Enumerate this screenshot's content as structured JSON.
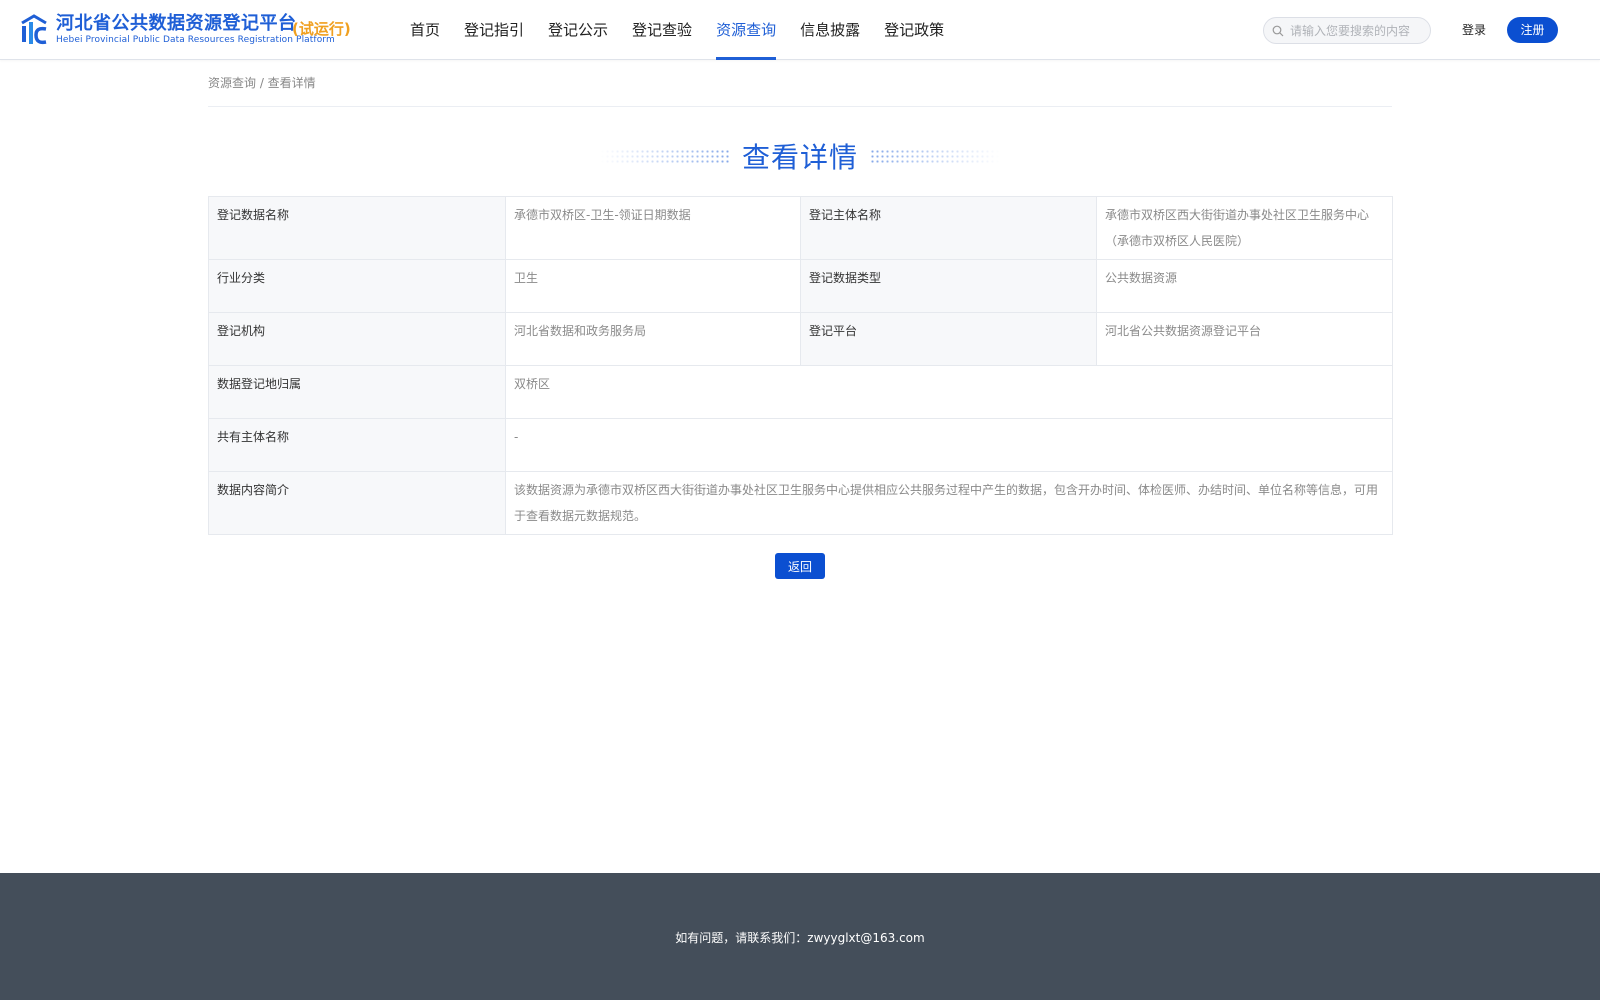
{
  "header": {
    "logo_title": "河北省公共数据资源登记平台",
    "logo_subtitle": "Hebei Provincial Public Data Resources Registration Platform",
    "logo_trial": "(试运行)",
    "nav": [
      "首页",
      "登记指引",
      "登记公示",
      "登记查验",
      "资源查询",
      "信息披露",
      "登记政策"
    ],
    "active_nav": "资源查询",
    "search_placeholder": "请输入您要搜索的内容",
    "login_label": "登录",
    "register_label": "注册",
    "accent_color": "#1f5fd6",
    "trial_color": "#f0a020"
  },
  "breadcrumb": "资源查询 / 查看详情",
  "page_title": "查看详情",
  "details": {
    "row1": {
      "label_a": "登记数据名称",
      "value_a": "承德市双桥区-卫生-领证日期数据",
      "label_b": "登记主体名称",
      "value_b": "承德市双桥区西大街街道办事处社区卫生服务中心（承德市双桥区人民医院）"
    },
    "row2": {
      "label_a": "行业分类",
      "value_a": "卫生",
      "label_b": "登记数据类型",
      "value_b": "公共数据资源"
    },
    "row3": {
      "label_a": "登记机构",
      "value_a": "河北省数据和政务服务局",
      "label_b": "登记平台",
      "value_b": "河北省公共数据资源登记平台"
    },
    "row4": {
      "label": "数据登记地归属",
      "value": "双桥区"
    },
    "row5": {
      "label": "共有主体名称",
      "value": "-"
    },
    "row6": {
      "label": "数据内容简介",
      "value": "该数据资源为承德市双桥区西大街街道办事处社区卫生服务中心提供相应公共服务过程中产生的数据，包含开办时间、体检医师、办结时间、单位名称等信息，可用于查看数据元数据规范。"
    }
  },
  "back_label": "返回",
  "footer_text": "如有问题，请联系我们：zwyyglxt@163.com",
  "footer_color": "#444e5a"
}
